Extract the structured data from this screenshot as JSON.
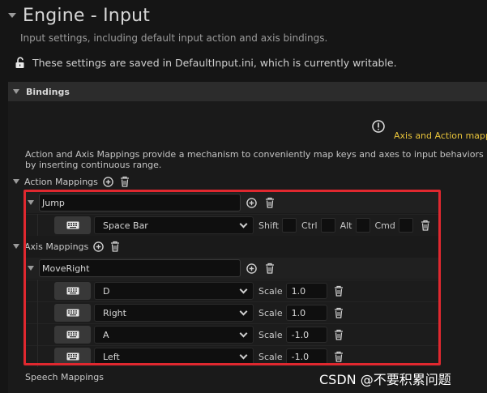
{
  "header": {
    "title": "Engine - Input",
    "subtitle": "Input settings, including default input action and axis bindings.",
    "lock_message": "These settings are saved in DefaultInput.ini, which is currently writable."
  },
  "bindings": {
    "section_label": "Bindings",
    "warning_text": "Axis and Action mappin",
    "description": "Action and Axis Mappings provide a mechanism to conveniently map keys and axes to input behaviors by inserting continuous range.",
    "action_mappings": {
      "label": "Action Mappings",
      "name": "Jump",
      "key": "Space Bar",
      "modifiers": [
        "Shift",
        "Ctrl",
        "Alt",
        "Cmd"
      ]
    },
    "axis_mappings": {
      "label": "Axis Mappings",
      "name": "MoveRight",
      "scale_label": "Scale",
      "rows": [
        {
          "key": "D",
          "scale": "1.0"
        },
        {
          "key": "Right",
          "scale": "1.0"
        },
        {
          "key": "A",
          "scale": "-1.0"
        },
        {
          "key": "Left",
          "scale": "-1.0"
        }
      ]
    },
    "speech_mappings": {
      "label": "Speech Mappings"
    }
  },
  "watermark": "CSDN @不要积累问题",
  "colors": {
    "highlight_box": "#e0282f",
    "warning": "#e8c33a",
    "background": "#151515"
  },
  "icons": [
    "lock-open-icon",
    "warning-icon",
    "add-icon",
    "trash-icon",
    "keyboard-icon",
    "chevron-down-icon"
  ]
}
